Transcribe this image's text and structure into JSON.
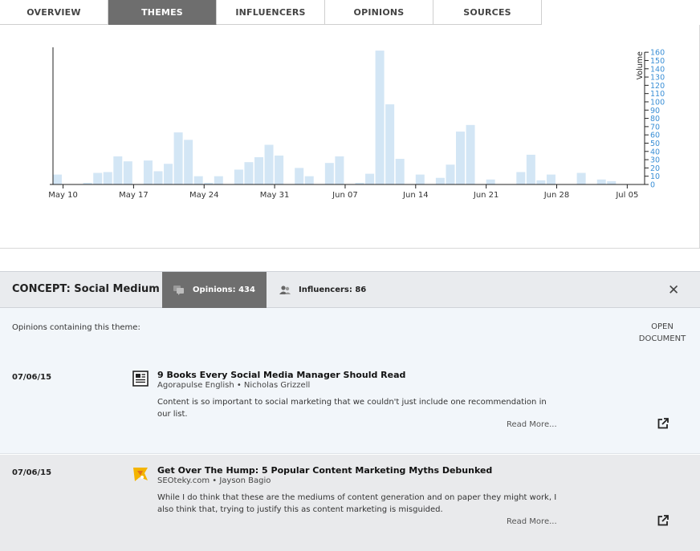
{
  "tabs": [
    {
      "label": "OVERVIEW",
      "active": false
    },
    {
      "label": "THEMES",
      "active": true
    },
    {
      "label": "INFLUENCERS",
      "active": false
    },
    {
      "label": "OPINIONS",
      "active": false
    },
    {
      "label": "SOURCES",
      "active": false
    }
  ],
  "chart_data": {
    "type": "bar",
    "x_tick_labels": [
      "May 10",
      "May 17",
      "May 24",
      "May 31",
      "Jun 07",
      "Jun 14",
      "Jun 21",
      "Jun 28",
      "Jul 05"
    ],
    "dates": [
      "May 09",
      "May 10",
      "May 11",
      "May 12",
      "May 13",
      "May 14",
      "May 15",
      "May 16",
      "May 17",
      "May 18",
      "May 19",
      "May 20",
      "May 21",
      "May 22",
      "May 23",
      "May 24",
      "May 25",
      "May 26",
      "May 27",
      "May 28",
      "May 29",
      "May 30",
      "May 31",
      "Jun 01",
      "Jun 02",
      "Jun 03",
      "Jun 04",
      "Jun 05",
      "Jun 06",
      "Jun 07",
      "Jun 08",
      "Jun 09",
      "Jun 10",
      "Jun 11",
      "Jun 12",
      "Jun 13",
      "Jun 14",
      "Jun 15",
      "Jun 16",
      "Jun 17",
      "Jun 18",
      "Jun 19",
      "Jun 20",
      "Jun 21",
      "Jun 22",
      "Jun 23",
      "Jun 24",
      "Jun 25",
      "Jun 26",
      "Jun 27",
      "Jun 28",
      "Jun 29",
      "Jun 30",
      "Jul 01",
      "Jul 02",
      "Jul 03",
      "Jul 04"
    ],
    "values": [
      12,
      0,
      0,
      2,
      14,
      15,
      34,
      28,
      0,
      29,
      16,
      25,
      63,
      54,
      10,
      2,
      10,
      0,
      18,
      27,
      33,
      48,
      35,
      0,
      20,
      10,
      0,
      26,
      34,
      0,
      2,
      13,
      162,
      97,
      31,
      0,
      12,
      0,
      8,
      24,
      64,
      72,
      0,
      6,
      0,
      0,
      15,
      36,
      5,
      12,
      0,
      0,
      14,
      0,
      6,
      4,
      0
    ],
    "ylabel": "Volume",
    "y_ticks": [
      0,
      10,
      20,
      30,
      40,
      50,
      60,
      70,
      80,
      90,
      100,
      110,
      120,
      130,
      140,
      150,
      160
    ],
    "ylim": [
      0,
      165
    ],
    "bar_color": "#d3e6f5",
    "tick_color": "#3a8fd6"
  },
  "concept": {
    "title": "CONCEPT: Social Medium",
    "opinions_tab": "Opinions: 434",
    "influencers_tab": "Influencers: 86"
  },
  "opinions": {
    "header_label": "Opinions containing this theme:",
    "open_document_line1": "OPEN",
    "open_document_line2": "DOCUMENT",
    "items": [
      {
        "date": "07/06/15",
        "title": "9 Books Every Social Media Manager Should Read",
        "byline": "Agorapulse English • Nicholas Grizzell",
        "excerpt": "Content is so important to social marketing that we couldn't just include one recommendation in our list.",
        "read_more": "Read More...",
        "icon": "newspaper-icon"
      },
      {
        "date": "07/06/15",
        "title": "Get Over The Hump: 5 Popular Content Marketing Myths Debunked",
        "byline": "SEOteky.com • Jayson Bagio",
        "excerpt": "While I do think that these are the mediums of content generation and on paper they might work, I also think that, trying to justify this as content marketing is misguided.",
        "read_more": "Read More...",
        "icon": "seoteky-logo-icon"
      }
    ]
  }
}
